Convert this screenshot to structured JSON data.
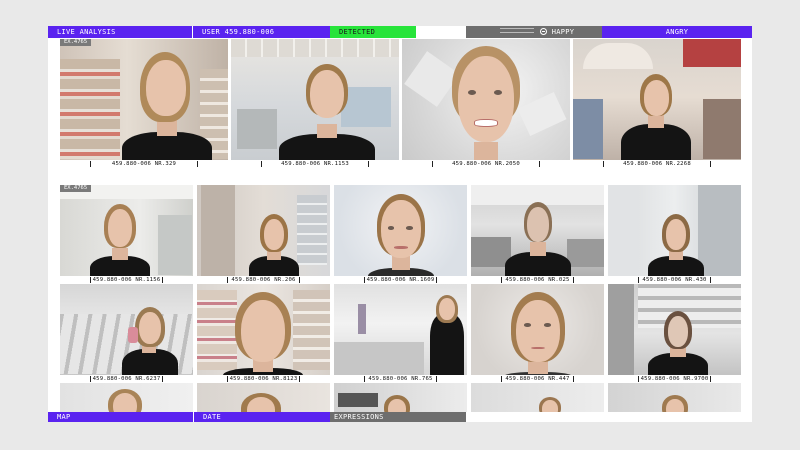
{
  "top_bar": {
    "live_analysis": "LIVE ANALYSIS",
    "user": "USER 459.880-006",
    "detected": "DETECTED",
    "happy": "HAPPY",
    "angry": "ANGRY"
  },
  "bottom_bar": {
    "map": "MAP",
    "date": "DATE",
    "expressions": "EXPRESSIONS"
  },
  "tags": {
    "row1": "EX.4765",
    "row2": "EX.4765"
  },
  "tiles_row1": [
    {
      "caption": "459.880-006 NR.329"
    },
    {
      "caption": "459.880-006 NR.1153"
    },
    {
      "caption": "459.880-006 NR.2050"
    },
    {
      "caption": "459.880-006 NR.2268"
    }
  ],
  "tiles_row2": [
    {
      "caption": "459.880-006 NR.1156"
    },
    {
      "caption": "459.880-006 NR.206"
    },
    {
      "caption": "459.880-006 NR.1609"
    },
    {
      "caption": "459.880-006 NR.025"
    },
    {
      "caption": "459.880-006 NR.430"
    }
  ],
  "tiles_row3": [
    {
      "caption": "459.880-006 NR.6237"
    },
    {
      "caption": "459.880-006 NR.8123"
    },
    {
      "caption": "459.880-006 NR.765"
    },
    {
      "caption": "459.880-006 NR.447"
    },
    {
      "caption": "459.880-006 NR.9700"
    }
  ],
  "colors": {
    "accent_purple": "#5a23f0",
    "detected_green": "#27e43a",
    "label_gray": "#6e6e6e"
  },
  "icons": {
    "happy": "face-icon"
  }
}
